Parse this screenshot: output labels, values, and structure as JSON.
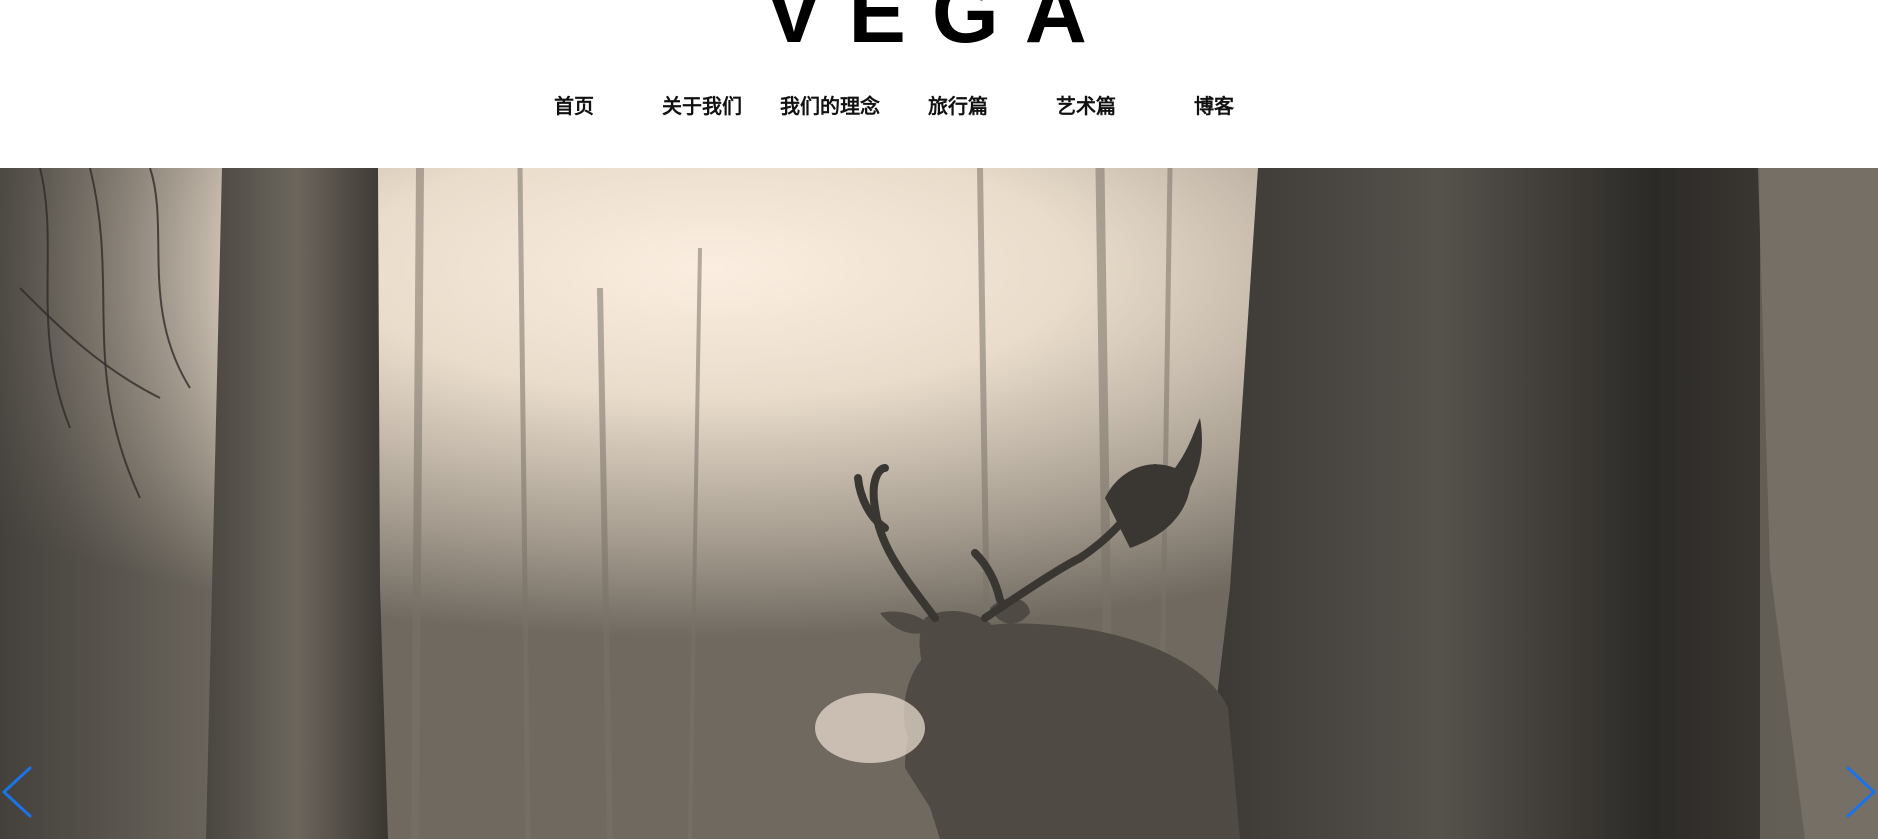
{
  "site": {
    "logo": "VEGA"
  },
  "nav": {
    "items": [
      {
        "label": "首页"
      },
      {
        "label": "关于我们"
      },
      {
        "label": "我们的理念"
      },
      {
        "label": "旅行篇"
      },
      {
        "label": "艺术篇"
      },
      {
        "label": "博客"
      }
    ]
  },
  "slider": {
    "prev_icon": "chevron-left-icon",
    "next_icon": "chevron-right-icon",
    "arrow_color": "#1a73e8"
  }
}
